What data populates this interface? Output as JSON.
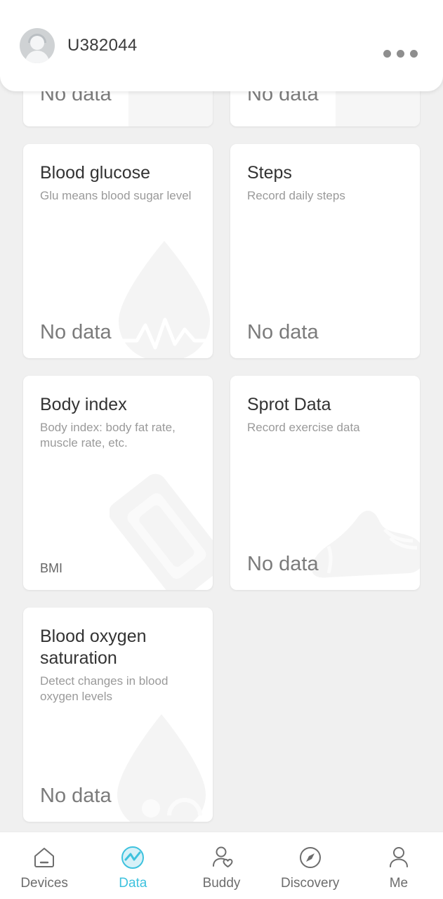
{
  "header": {
    "username": "U382044",
    "avatar_icon": "user-avatar-icon",
    "more_icon": "more-options-icon"
  },
  "colors": {
    "background": "#f0f0f0",
    "card": "#ffffff",
    "title_text": "#333333",
    "sub_text": "#9a9a9a",
    "value_text": "#7b7b7b",
    "accent": "#3ec2de",
    "nav_text": "#6d6d6d",
    "watermark": "#f4f4f4"
  },
  "main": {
    "cards": [
      {
        "id": "clipped-left",
        "title": "",
        "subtitle": "",
        "value": "No data",
        "watermark_icon": ""
      },
      {
        "id": "clipped-right",
        "title": "",
        "subtitle": "",
        "value": "No data",
        "watermark_icon": ""
      },
      {
        "id": "blood-glucose",
        "title": "Blood glucose",
        "subtitle": "Glu means blood sugar level",
        "value": "No data",
        "watermark_icon": "blood-drop-waveform-icon"
      },
      {
        "id": "steps",
        "title": "Steps",
        "subtitle": "Record daily steps",
        "value": "No data",
        "watermark_icon": ""
      },
      {
        "id": "body-index",
        "title": "Body index",
        "subtitle": "Body index: body fat rate, muscle rate, etc.",
        "value": "BMI",
        "watermark_icon": "body-scale-icon"
      },
      {
        "id": "sprot-data",
        "title": "Sprot Data",
        "subtitle": "Record exercise data",
        "value": "No data",
        "watermark_icon": "running-shoe-icon"
      },
      {
        "id": "blood-oxygen",
        "title": "Blood oxygen saturation",
        "subtitle": "Detect changes in blood oxygen levels",
        "value": "No data",
        "watermark_icon": "blood-drop-icon"
      }
    ]
  },
  "bottom_nav": {
    "items": [
      {
        "label": "Devices",
        "icon": "home-icon",
        "active": false
      },
      {
        "label": "Data",
        "icon": "pulse-icon",
        "active": true
      },
      {
        "label": "Buddy",
        "icon": "person-heart-icon",
        "active": false
      },
      {
        "label": "Discovery",
        "icon": "compass-icon",
        "active": false
      },
      {
        "label": "Me",
        "icon": "person-icon",
        "active": false
      }
    ]
  }
}
